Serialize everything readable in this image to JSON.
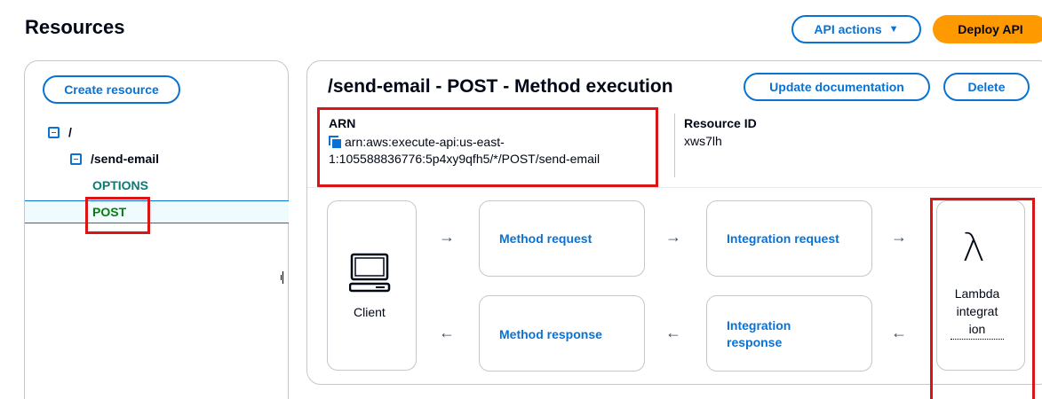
{
  "header": {
    "title": "Resources",
    "api_actions_label": "API actions",
    "deploy_api_label": "Deploy API"
  },
  "sidebar": {
    "create_resource_label": "Create resource",
    "tree": {
      "root": "/",
      "resource": "/send-email",
      "methods": [
        "OPTIONS",
        "POST"
      ]
    }
  },
  "method_execution": {
    "title": "/send-email - POST - Method execution",
    "update_documentation_label": "Update documentation",
    "delete_label": "Delete",
    "arn_label": "ARN",
    "arn_line1": "arn:aws:execute-api:us-east-",
    "arn_line2": "1:105588836776:5p4xy9qfh5/*/POST/send-email",
    "resource_id_label": "Resource ID",
    "resource_id_value": "xws7lh"
  },
  "flow": {
    "client_label": "Client",
    "method_request": "Method request",
    "integration_request": "Integration request",
    "method_response": "Method response",
    "integration_response_line1": "Integration",
    "integration_response_line2": "response",
    "lambda_line1": "Lambda",
    "lambda_line2": "integrat",
    "lambda_line3": "ion",
    "lambda_symbol": "λ",
    "arrow_right": "→",
    "arrow_left": "←"
  },
  "colors": {
    "link_blue": "#0972d3",
    "deploy_orange": "#ff9900",
    "post_green": "#037f0c",
    "options_teal": "#067c74",
    "highlight_red": "#d91515"
  }
}
